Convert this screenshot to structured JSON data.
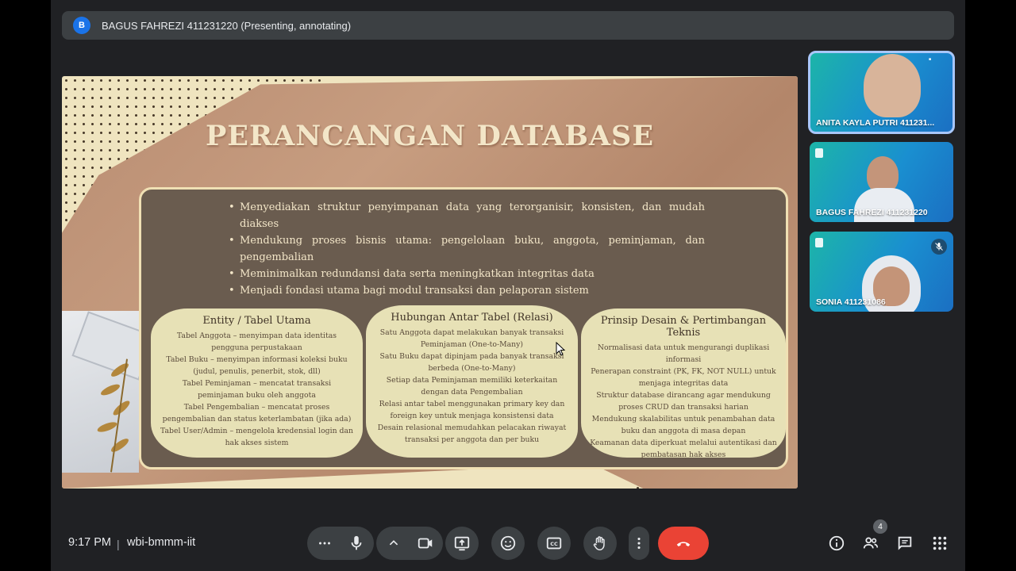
{
  "banner": {
    "avatar_letter": "B",
    "presenter_text": "BAGUS FAHREZI 411231220 (Presenting, annotating)"
  },
  "slide": {
    "title": "PERANCANGAN DATABASE",
    "bullets": [
      "Menyediakan struktur penyimpanan data yang terorganisir, konsisten, dan mudah diakses",
      "Mendukung proses bisnis utama: pengelolaan buku, anggota, peminjaman, dan pengembalian",
      "Meminimalkan redundansi data serta meningkatkan integritas data",
      "Menjadi fondasi utama bagi modul transaksi dan pelaporan sistem"
    ],
    "cards": [
      {
        "heading": "Entity / Tabel Utama",
        "lines": [
          "Tabel Anggota – menyimpan data identitas pengguna perpustakaan",
          "Tabel Buku – menyimpan informasi koleksi buku (judul, penulis, penerbit, stok, dll)",
          "Tabel Peminjaman – mencatat transaksi peminjaman buku oleh anggota",
          "Tabel Pengembalian – mencatat proses pengembalian dan status keterlambatan (jika ada)",
          "Tabel User/Admin – mengelola kredensial login dan hak akses sistem"
        ]
      },
      {
        "heading": "Hubungan Antar Tabel (Relasi)",
        "lines": [
          "Satu Anggota dapat melakukan banyak transaksi Peminjaman (One-to-Many)",
          "Satu Buku dapat dipinjam pada banyak transaksi berbeda (One-to-Many)",
          "Setiap data Peminjaman memiliki keterkaitan dengan data Pengembalian",
          "Relasi antar tabel menggunakan primary key dan foreign key untuk menjaga konsistensi data",
          "Desain relasional memudahkan pelacakan riwayat transaksi per anggota dan per buku"
        ]
      },
      {
        "heading": "Prinsip Desain & Pertimbangan Teknis",
        "lines": [
          "Normalisasi data untuk mengurangi duplikasi informasi",
          "Penerapan constraint (PK, FK, NOT NULL) untuk menjaga integritas data",
          "Struktur database dirancang agar mendukung proses CRUD dan transaksi harian",
          "Mendukung skalabilitas untuk penambahan data buku dan anggota di masa depan",
          "Keamanan data diperkuat melalui autentikasi dan pembatasan hak akses"
        ]
      }
    ]
  },
  "participants": [
    {
      "name": "ANITA KAYLA PUTRI 411231...",
      "active": true,
      "muted": false
    },
    {
      "name": "BAGUS FAHREZI 411231220",
      "active": false,
      "muted": false
    },
    {
      "name": "SONIA 411231086",
      "active": false,
      "muted": true
    }
  ],
  "bottom": {
    "time": "9:17 PM",
    "separator": "|",
    "meeting_code": "wbi-bmmm-iit",
    "people_count": "4"
  },
  "colors": {
    "meet_bg": "#202124",
    "control_bg": "#3c4043",
    "leave_red": "#ea4335",
    "accent_blue": "#1a73e8"
  }
}
